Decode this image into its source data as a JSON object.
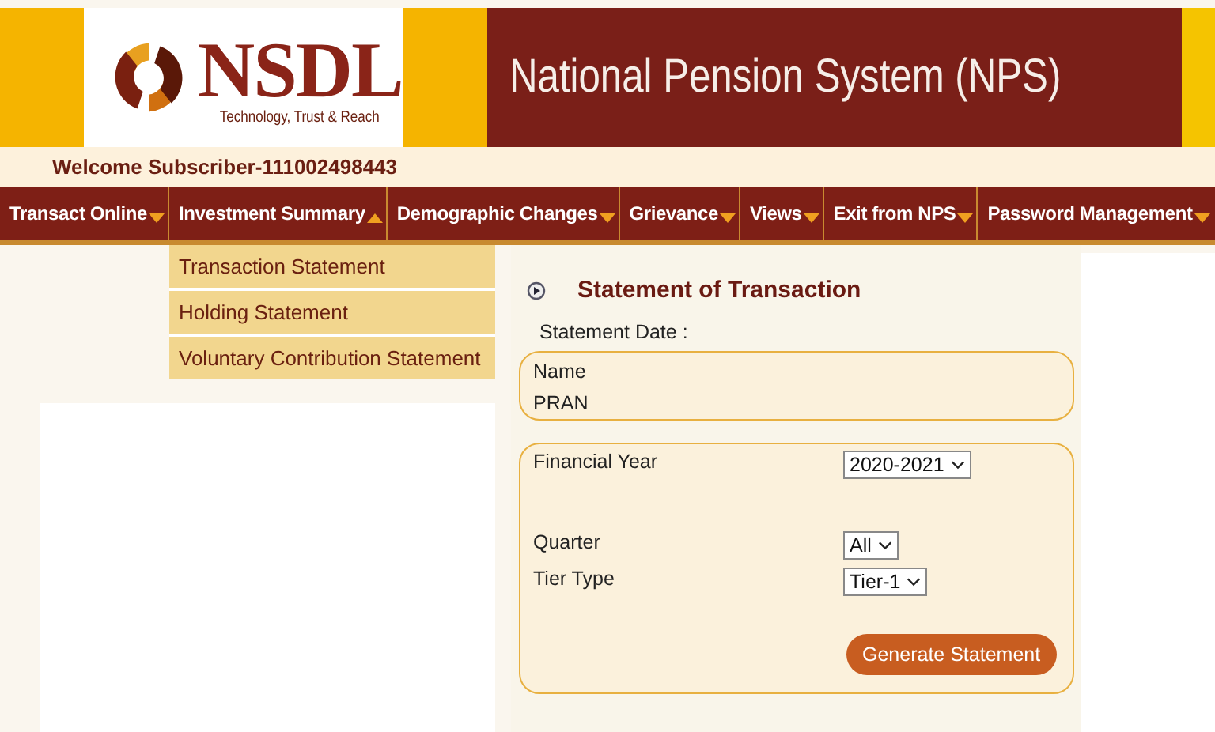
{
  "header": {
    "logo_name": "NSDL",
    "logo_tagline": "Technology, Trust & Reach",
    "title": "National Pension System (NPS)"
  },
  "welcome": "Welcome Subscriber-111002498443",
  "nav": [
    {
      "label": "Transact Online",
      "expanded": false
    },
    {
      "label": "Investment Summary",
      "expanded": true,
      "submenu": [
        "Transaction Statement",
        "Holding Statement",
        "Voluntary Contribution Statement"
      ]
    },
    {
      "label": "Demographic Changes",
      "expanded": false
    },
    {
      "label": "Grievance",
      "expanded": false
    },
    {
      "label": "Views",
      "expanded": false
    },
    {
      "label": "Exit from NPS",
      "expanded": false
    },
    {
      "label": "Password Management",
      "expanded": false
    }
  ],
  "content": {
    "heading": "Statement of Transaction",
    "statement_date_label": "Statement Date :",
    "info": [
      "Name",
      "PRAN"
    ],
    "form": {
      "financial_year": {
        "label": "Financial Year",
        "value": "2020-2021"
      },
      "quarter": {
        "label": "Quarter",
        "value": "All"
      },
      "tier_type": {
        "label": "Tier Type",
        "value": "Tier-1"
      },
      "button": "Generate Statement"
    }
  }
}
